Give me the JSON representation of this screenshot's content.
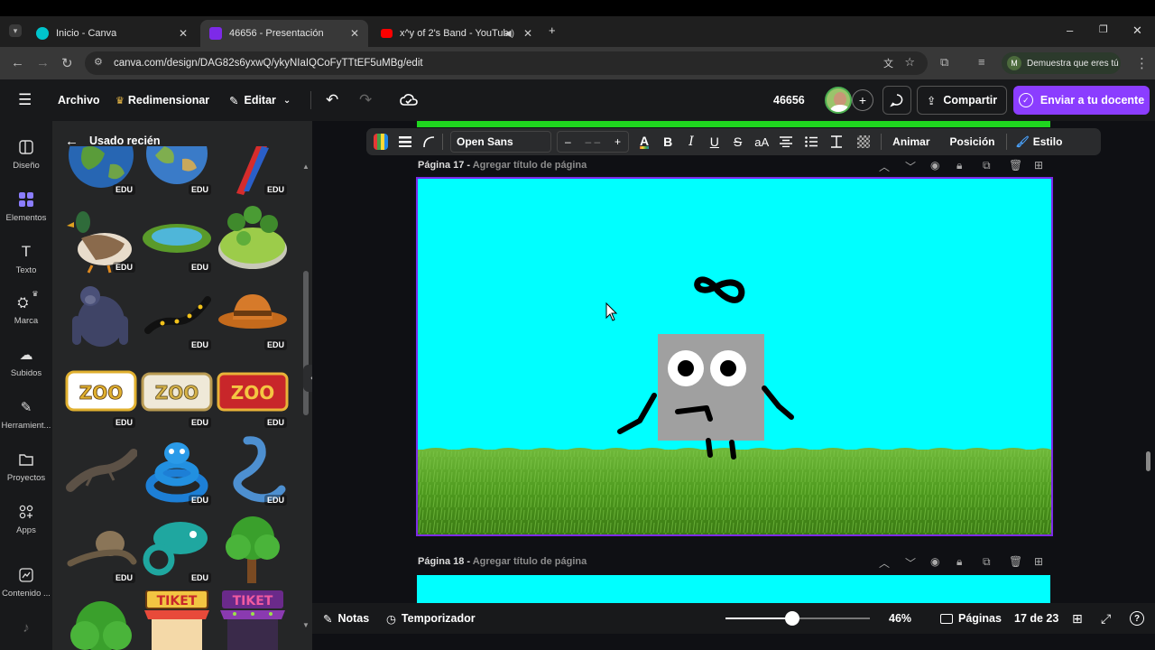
{
  "browser": {
    "tabs": [
      {
        "title": "Inicio - Canva",
        "favicon_color": "#00c4cc"
      },
      {
        "title": "46656 - Presentación",
        "favicon_color": "#7d2ae8"
      },
      {
        "title": "x^y of 2's Band - YouTube",
        "favicon_color": "#ff0000"
      }
    ],
    "url": "canva.com/design/DAG82s6yxwQ/ykyNIaIQCoFyTTtEF5uMBg/edit",
    "profile_initial": "M",
    "profile_label": "Demuestra que eres tú"
  },
  "header": {
    "menu": [
      "Archivo",
      "Redimensionar",
      "Editar"
    ],
    "design_title": "46656",
    "share_label": "Compartir",
    "send_label": "Enviar a tu docente"
  },
  "rail": {
    "items": [
      "Diseño",
      "Elementos",
      "Texto",
      "Marca",
      "Subidos",
      "Herramient...",
      "Proyectos",
      "Apps",
      "Contenido ..."
    ]
  },
  "panel": {
    "title": "Usado recién",
    "badge": "EDU",
    "zoo_text": "ZOO",
    "ticket_text": "TIKET"
  },
  "toolbar": {
    "font": "Open Sans",
    "minus": "–",
    "size": "– –",
    "plus": "+",
    "case": "aA",
    "animate": "Animar",
    "position": "Posición",
    "style": "Estilo"
  },
  "pages": [
    {
      "label": "Página 17 -",
      "sub": "Agregar título de página",
      "background": "#00ffff",
      "character_symbol": "∞"
    },
    {
      "label": "Página 18 -",
      "sub": "Agregar título de página",
      "background": "#00ffff"
    }
  ],
  "bottom": {
    "notes": "Notas",
    "timer": "Temporizador",
    "zoom": "46%",
    "zoom_fraction": 0.46,
    "pages_label": "Páginas",
    "page_count": "17 de 23"
  },
  "colors": {
    "accent": "#8b3dff",
    "canvas_bg": "#00ffff",
    "grass": "#4e9a1e"
  }
}
